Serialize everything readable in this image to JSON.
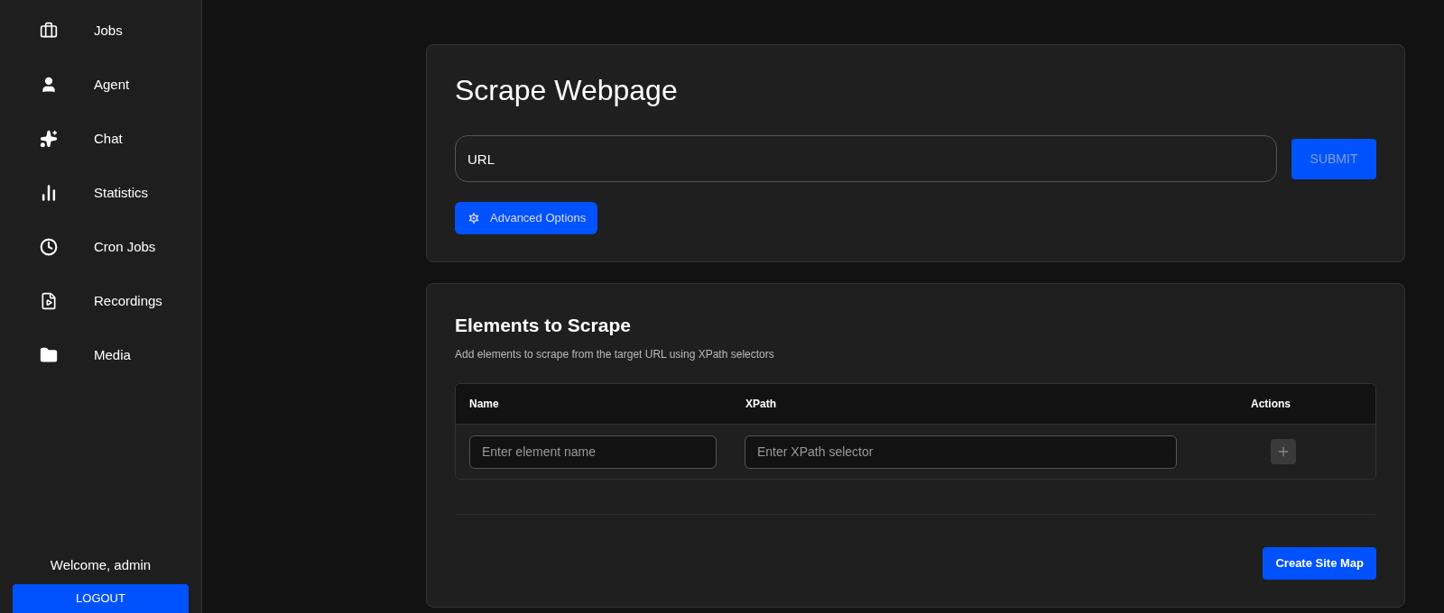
{
  "sidebar": {
    "items": [
      {
        "label": "Jobs"
      },
      {
        "label": "Agent"
      },
      {
        "label": "Chat"
      },
      {
        "label": "Statistics"
      },
      {
        "label": "Cron Jobs"
      },
      {
        "label": "Recordings"
      },
      {
        "label": "Media"
      }
    ],
    "welcome": "Welcome, admin",
    "logout": "LOGOUT"
  },
  "scrape_card": {
    "title": "Scrape Webpage",
    "url_field": {
      "placeholder": "URL"
    },
    "submit": {
      "label": "SUBMIT",
      "disabled": true
    },
    "advanced": "Advanced Options"
  },
  "elements_card": {
    "title": "Elements to Scrape",
    "subtitle": "Add elements to scrape from the target URL using XPath selectors",
    "table": {
      "columns": [
        "Name",
        "XPath",
        "Actions"
      ],
      "name_field": {
        "placeholder": "Enter element name"
      },
      "xpath_field": {
        "placeholder": "Enter XPath selector"
      }
    },
    "create": "Create Site Map"
  }
}
